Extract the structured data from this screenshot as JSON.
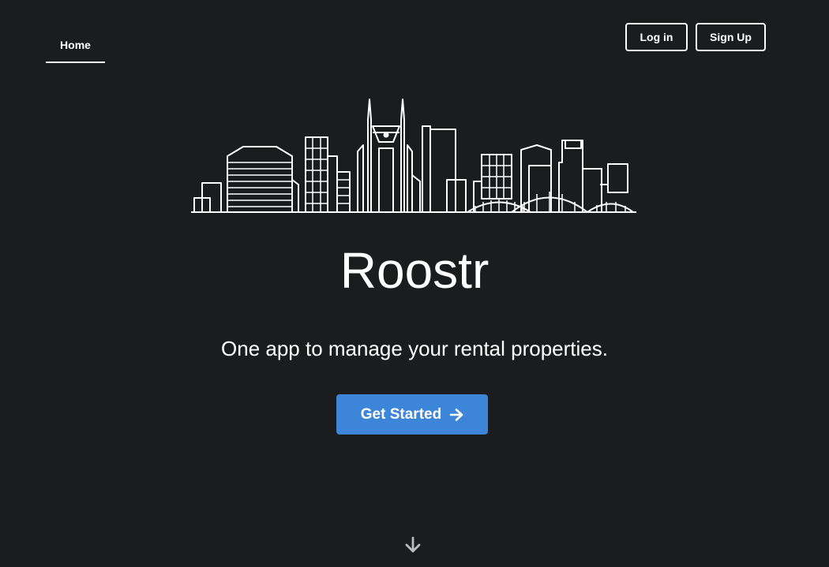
{
  "nav": {
    "home_label": "Home"
  },
  "auth": {
    "login_label": "Log in",
    "signup_label": "Sign Up"
  },
  "hero": {
    "logo": "city-skyline-icon",
    "title": "Roostr",
    "tagline": "One app to manage your rental properties.",
    "cta_label": "Get Started",
    "cta_icon": "arrow-right-icon",
    "scroll_icon": "arrow-down-icon"
  },
  "colors": {
    "background": "#1b1c1d",
    "text": "#ffffff",
    "accent": "#3d85d8"
  }
}
